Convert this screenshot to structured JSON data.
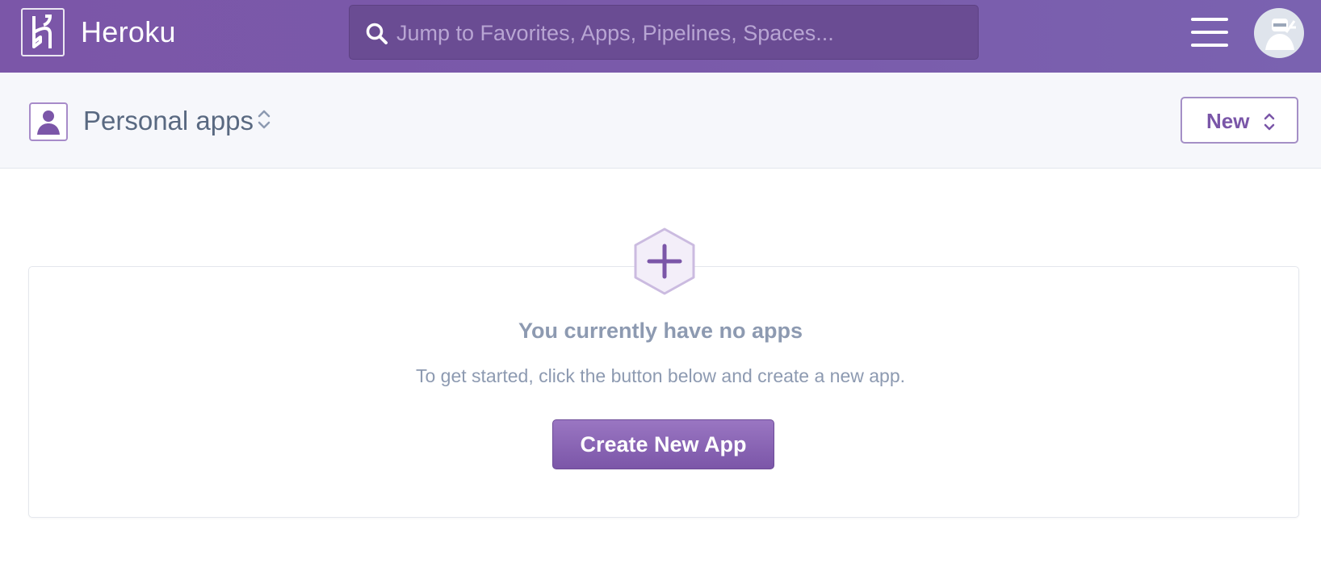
{
  "header": {
    "brand_name": "Heroku",
    "search_placeholder": "Jump to Favorites, Apps, Pipelines, Spaces...",
    "icons": {
      "logo": "heroku-logo-icon",
      "search": "search-icon",
      "menu": "hamburger-menu-icon",
      "avatar": "user-avatar-icon"
    }
  },
  "subheader": {
    "context_label": "Personal apps",
    "new_button_label": "New",
    "icons": {
      "context": "person-icon",
      "switcher": "chevron-up-down-icon"
    }
  },
  "empty_state": {
    "title": "You currently have no apps",
    "subtitle": "To get started, click the button below and create a new app.",
    "button_label": "Create New App",
    "icon": "hexagon-plus-icon"
  },
  "colors": {
    "brand_purple": "#7b56a8",
    "search_bg": "#6a4c93",
    "subheader_bg": "#f6f7fb",
    "muted_text": "#8d9ab1",
    "context_text": "#596981"
  }
}
